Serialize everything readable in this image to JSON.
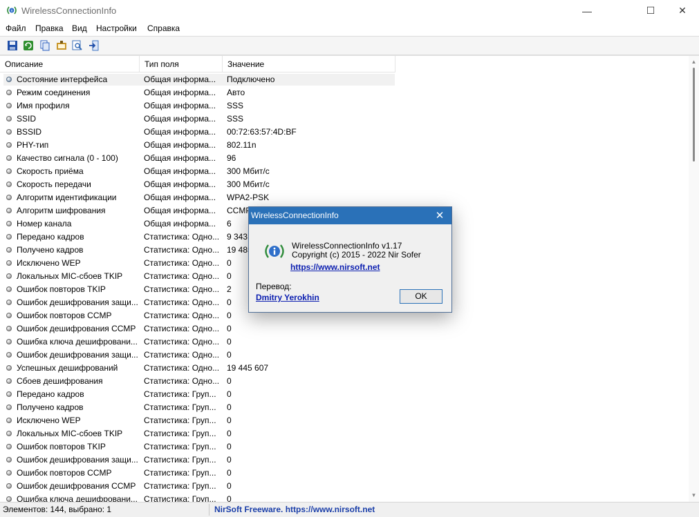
{
  "window": {
    "title": "WirelessConnectionInfo",
    "minimize_glyph": "—",
    "maximize_glyph": "☐",
    "close_glyph": "✕"
  },
  "menu": [
    "Файл",
    "Правка",
    "Вид",
    "Настройки",
    "Справка"
  ],
  "toolbar": [
    {
      "name": "save-icon",
      "color": "#1f4ea8"
    },
    {
      "name": "refresh-icon",
      "color": "#2f8f2f"
    },
    {
      "name": "copy-icon",
      "color": "#2b5fbf"
    },
    {
      "name": "properties-icon",
      "color": "#c8962a"
    },
    {
      "name": "find-icon",
      "color": "#3b6fb8"
    },
    {
      "name": "exit-icon",
      "color": "#4176c4"
    }
  ],
  "columns": [
    "Описание",
    "Тип поля",
    "Значение"
  ],
  "rows": [
    {
      "desc": "Состояние интерфейса",
      "type": "Общая информа...",
      "value": "Подключено"
    },
    {
      "desc": "Режим соединения",
      "type": "Общая информа...",
      "value": "Авто"
    },
    {
      "desc": "Имя профиля",
      "type": "Общая информа...",
      "value": "SSS"
    },
    {
      "desc": "SSID",
      "type": "Общая информа...",
      "value": "SSS"
    },
    {
      "desc": "BSSID",
      "type": "Общая информа...",
      "value": "00:72:63:57:4D:BF"
    },
    {
      "desc": "PHY-тип",
      "type": "Общая информа...",
      "value": "802.11n"
    },
    {
      "desc": "Качество сигнала (0 - 100)",
      "type": "Общая информа...",
      "value": "96"
    },
    {
      "desc": "Скорость приёма",
      "type": "Общая информа...",
      "value": "300 Мбит/с"
    },
    {
      "desc": "Скорость передачи",
      "type": "Общая информа...",
      "value": "300 Мбит/с"
    },
    {
      "desc": "Алгоритм идентификации",
      "type": "Общая информа...",
      "value": "WPA2-PSK"
    },
    {
      "desc": "Алгоритм шифрования",
      "type": "Общая информа...",
      "value": "CCMP"
    },
    {
      "desc": "Номер канала",
      "type": "Общая информа...",
      "value": "6"
    },
    {
      "desc": "Передано кадров",
      "type": "Статистика: Одно...",
      "value": "9 343"
    },
    {
      "desc": "Получено кадров",
      "type": "Статистика: Одно...",
      "value": "19 485"
    },
    {
      "desc": "Исключено WEP",
      "type": "Статистика: Одно...",
      "value": "0"
    },
    {
      "desc": "Локальных MIC-сбоев TKIP",
      "type": "Статистика: Одно...",
      "value": "0"
    },
    {
      "desc": "Ошибок повторов TKIP",
      "type": "Статистика: Одно...",
      "value": "2"
    },
    {
      "desc": "Ошибок дешифрования защи...",
      "type": "Статистика: Одно...",
      "value": "0"
    },
    {
      "desc": "Ошибок повторов CCMP",
      "type": "Статистика: Одно...",
      "value": "0"
    },
    {
      "desc": "Ошибок дешифрования CCMP",
      "type": "Статистика: Одно...",
      "value": "0"
    },
    {
      "desc": "Ошибка ключа дешифровани...",
      "type": "Статистика: Одно...",
      "value": "0"
    },
    {
      "desc": "Ошибок дешифрования защи...",
      "type": "Статистика: Одно...",
      "value": "0"
    },
    {
      "desc": "Успешных дешифрований",
      "type": "Статистика: Одно...",
      "value": "19 445 607"
    },
    {
      "desc": "Сбоев дешифрования",
      "type": "Статистика: Одно...",
      "value": "0"
    },
    {
      "desc": "Передано кадров",
      "type": "Статистика: Груп...",
      "value": "0"
    },
    {
      "desc": "Получено кадров",
      "type": "Статистика: Груп...",
      "value": "0"
    },
    {
      "desc": "Исключено WEP",
      "type": "Статистика: Груп...",
      "value": "0"
    },
    {
      "desc": "Локальных MIC-сбоев TKIP",
      "type": "Статистика: Груп...",
      "value": "0"
    },
    {
      "desc": "Ошибок повторов TKIP",
      "type": "Статистика: Груп...",
      "value": "0"
    },
    {
      "desc": "Ошибок дешифрования защи...",
      "type": "Статистика: Груп...",
      "value": "0"
    },
    {
      "desc": "Ошибок повторов CCMP",
      "type": "Статистика: Груп...",
      "value": "0"
    },
    {
      "desc": "Ошибок дешифрования CCMP",
      "type": "Статистика: Груп...",
      "value": "0"
    },
    {
      "desc": "Ошибка ключа дешифровани...",
      "type": "Статистика: Груп...",
      "value": "0"
    }
  ],
  "selected_row": 0,
  "status": {
    "left": "Элементов: 144, выбрано: 1",
    "right": "NirSoft Freeware. https://www.nirsoft.net"
  },
  "dialog": {
    "title": "WirelessConnectionInfo",
    "close_glyph": "✕",
    "line1": "WirelessConnectionInfo v1.17",
    "line2": "Copyright (c) 2015 - 2022 Nir Sofer",
    "link": "https://www.nirsoft.net",
    "translation_label": "Перевод:",
    "translator": "Dmitry Yerokhin",
    "ok_label": "OK"
  }
}
